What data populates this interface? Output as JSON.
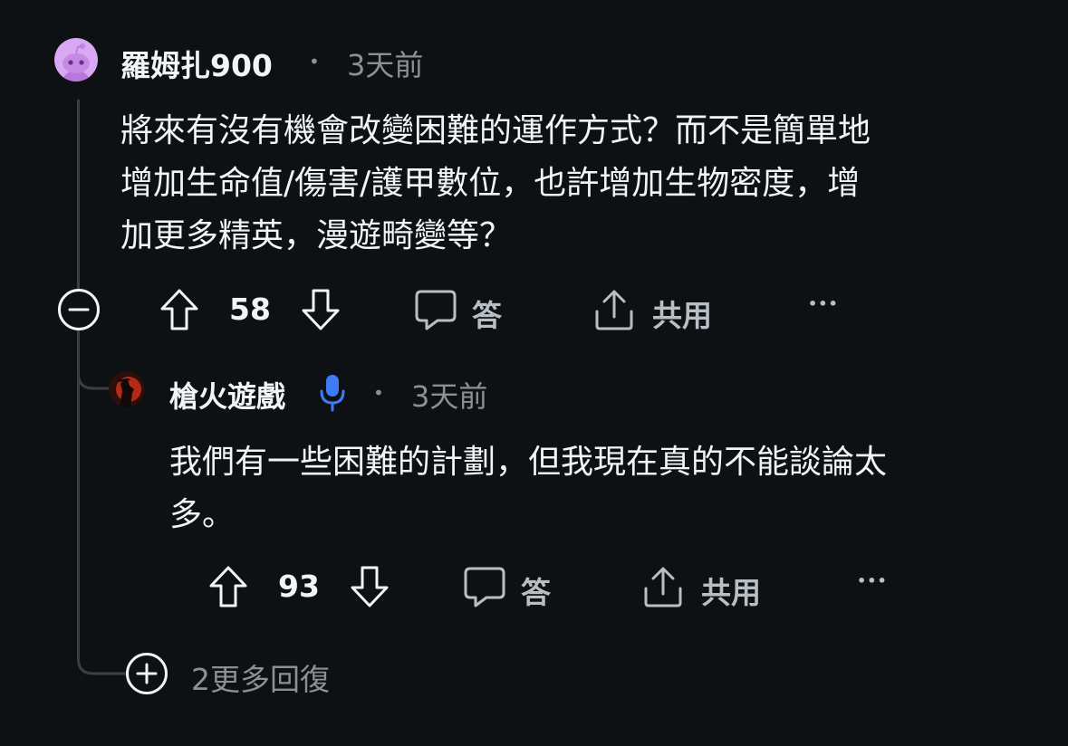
{
  "comment": {
    "username": "羅姆扎900",
    "separator": "•",
    "timestamp": "3天前",
    "body_lines": [
      "將來有沒有機會改變困難的運作方式？而不是簡單地",
      "增加生命值/傷害/護甲數位，也許增加生物密度，增",
      "加更多精英，漫遊畸變等？"
    ],
    "votes": "58",
    "reply_label": "答",
    "share_label": "共用",
    "more_label": "•••"
  },
  "reply": {
    "username": "槍火遊戲",
    "separator": "•",
    "timestamp": "3天前",
    "body_lines": [
      "我們有一些困難的計劃，但我現在真的不能談論太",
      "多。"
    ],
    "votes": "93",
    "reply_label": "答",
    "share_label": "共用",
    "more_label": "•••"
  },
  "more_replies_label": "2更多回復",
  "colors": {
    "background": "#0e1113",
    "text": "#f2f4f5",
    "muted": "#8a9196",
    "thread_line": "#3a3f42",
    "avatar_snoo": "#d9a8f3",
    "dev_badge": "#3d7bf7"
  },
  "icons": [
    "snoo-avatar-icon",
    "collapse-icon",
    "upvote-icon",
    "downvote-icon",
    "comment-bubble-icon",
    "share-icon",
    "more-icon",
    "microphone-badge-icon",
    "expand-icon"
  ]
}
